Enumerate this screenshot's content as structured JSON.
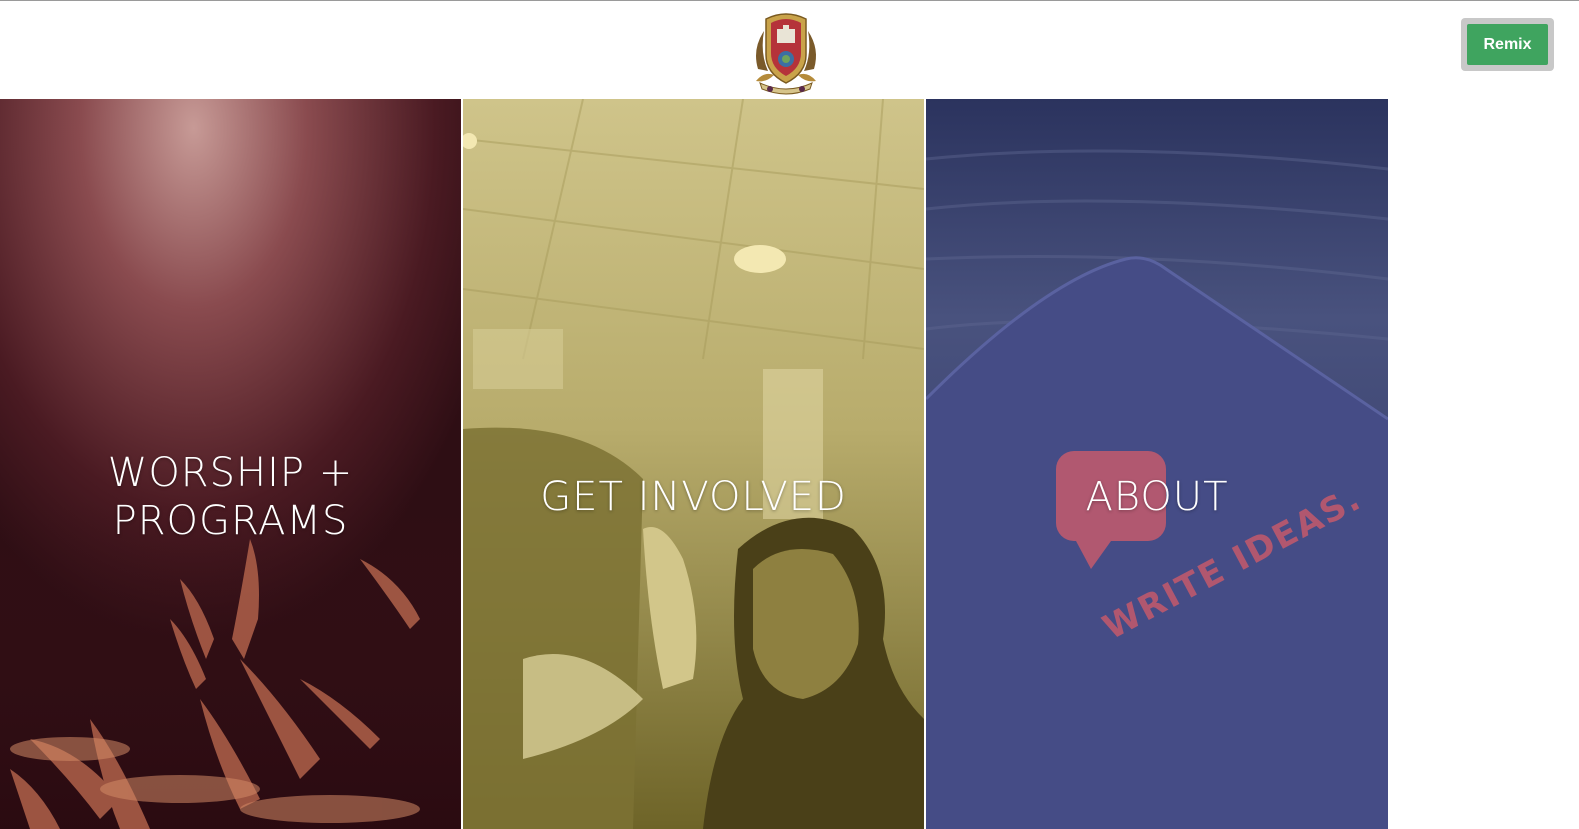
{
  "header": {
    "logo": "church-crest-logo",
    "remix_label": "Remix",
    "remix_color": "#3fa45f"
  },
  "panels": [
    {
      "label": "WORSHIP +\nPROGRAMS",
      "tint": "#5a1f26",
      "image": "raised-hands-concert-photo"
    },
    {
      "label": "GET INVOLVED",
      "tint": "#9c8f4a",
      "image": "man-clapping-in-congregation-photo"
    },
    {
      "label": "ABOUT",
      "tint": "#2d3466",
      "image": "notebook-write-ideas-photo"
    }
  ],
  "photo_text": {
    "notebook_brand": "WRITE IDEAS."
  }
}
